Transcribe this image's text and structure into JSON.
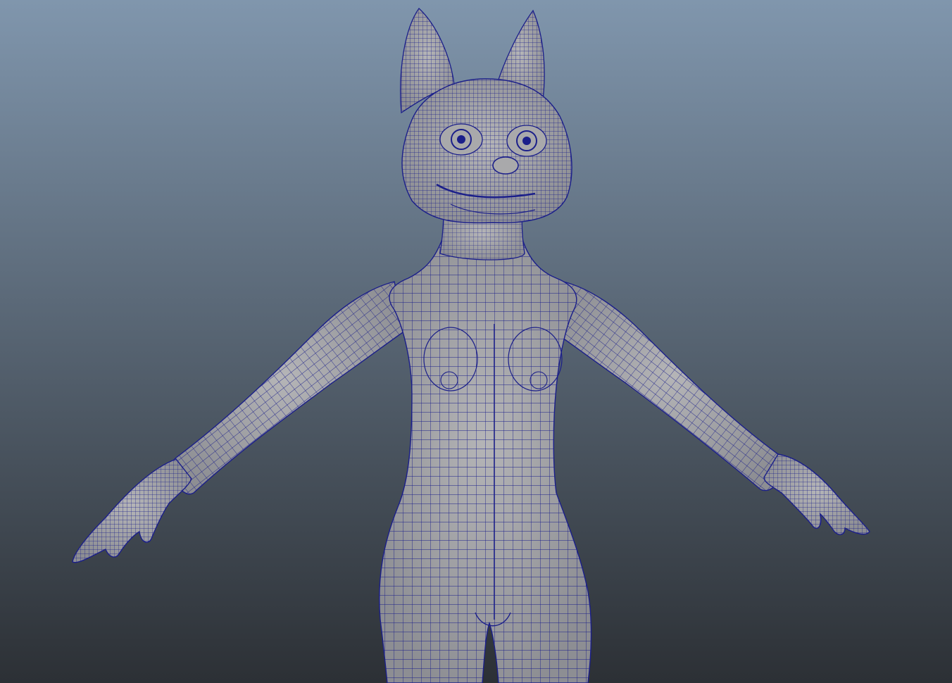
{
  "viewport": {
    "background_top": "#8096ad",
    "background_bottom": "#2c3035",
    "mesh_fill": "#a9a9ab",
    "mesh_shadow": "#7c7d84",
    "wire_color": "#1b1f8a",
    "model": {
      "kind": "character-mesh",
      "shading": "wireframe-on-shaded",
      "pose": "a-pose"
    }
  }
}
